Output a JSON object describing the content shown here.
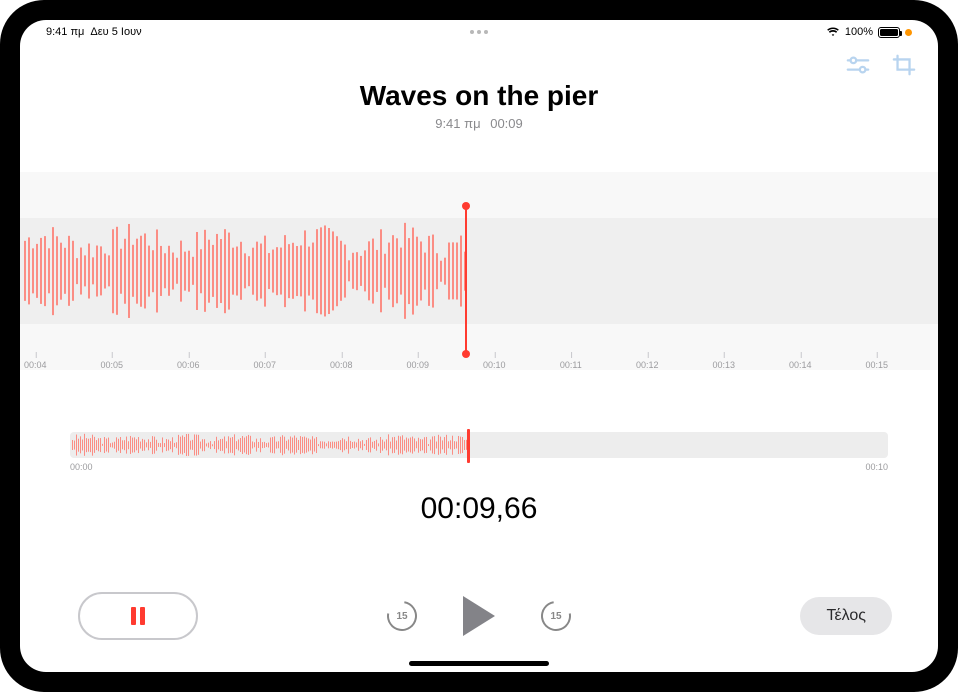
{
  "status": {
    "time": "9:41 πμ",
    "date": "Δευ 5 Ιουν",
    "battery_pct": "100%"
  },
  "toolbar": {},
  "recording": {
    "title": "Waves on the pier",
    "subtitle_time": "9:41 πμ",
    "subtitle_duration": "00:09"
  },
  "timeline": {
    "ticks": [
      "00:04",
      "00:05",
      "00:06",
      "00:07",
      "00:08",
      "00:09",
      "00:10",
      "00:11",
      "00:12",
      "00:13",
      "00:14",
      "00:15"
    ],
    "playhead_fraction": 0.485
  },
  "overview": {
    "start_label": "00:00",
    "end_label": "00:10",
    "cursor_fraction": 0.485
  },
  "timecode": "00:09,66",
  "controls": {
    "skip_back_sec": "15",
    "skip_fwd_sec": "15",
    "done_label": "Τέλος"
  }
}
